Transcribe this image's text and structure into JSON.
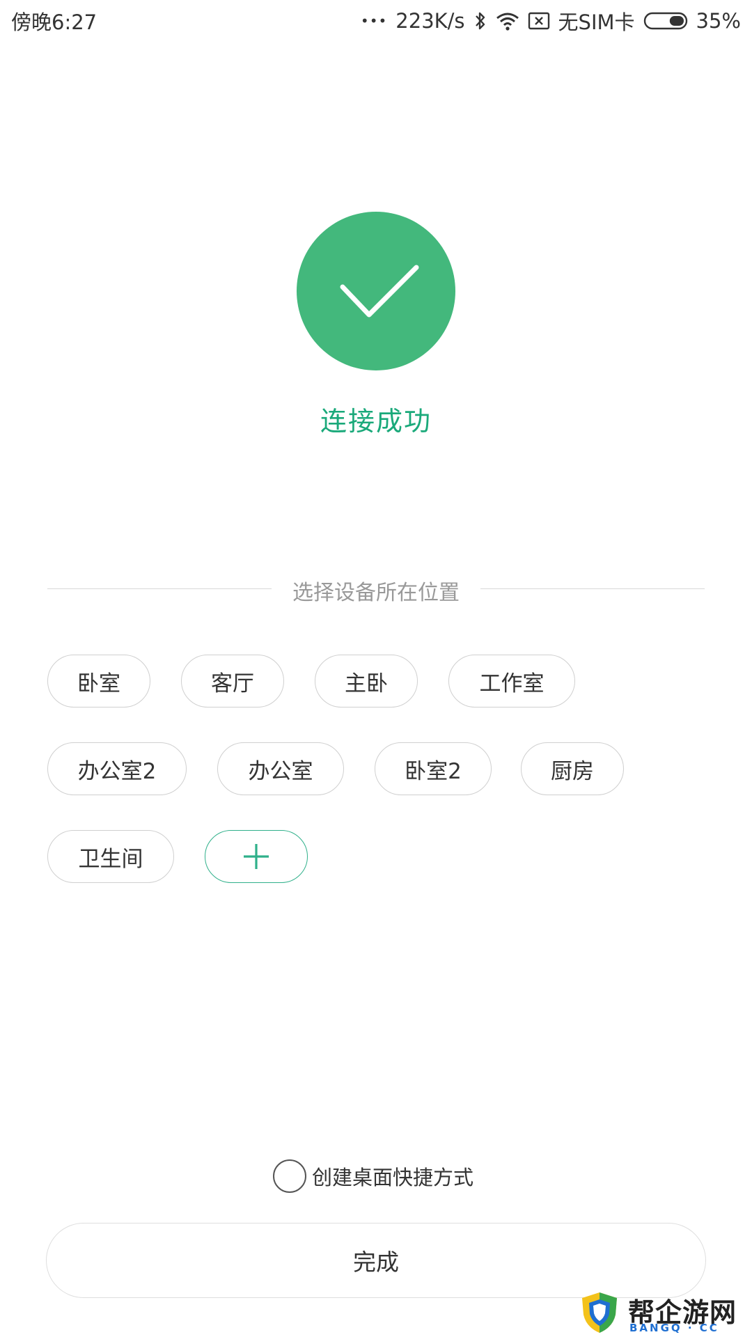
{
  "status_bar": {
    "time": "傍晚6:27",
    "dots": "•••",
    "speed": "223K/s",
    "sim": "无SIM卡",
    "battery": "35%",
    "battery_level": 0.35
  },
  "success": {
    "text": "连接成功",
    "color": "#43b87c"
  },
  "location": {
    "heading": "选择设备所在位置",
    "chips": [
      "卧室",
      "客厅",
      "主卧",
      "工作室",
      "办公室2",
      "办公室",
      "卧室2",
      "厨房",
      "卫生间"
    ],
    "add_label": "+"
  },
  "shortcut": {
    "label": "创建桌面快捷方式",
    "checked": false
  },
  "done_button": {
    "label": "完成"
  },
  "watermark": {
    "text": "帮企游网",
    "sub": "BANGQ · CC"
  }
}
